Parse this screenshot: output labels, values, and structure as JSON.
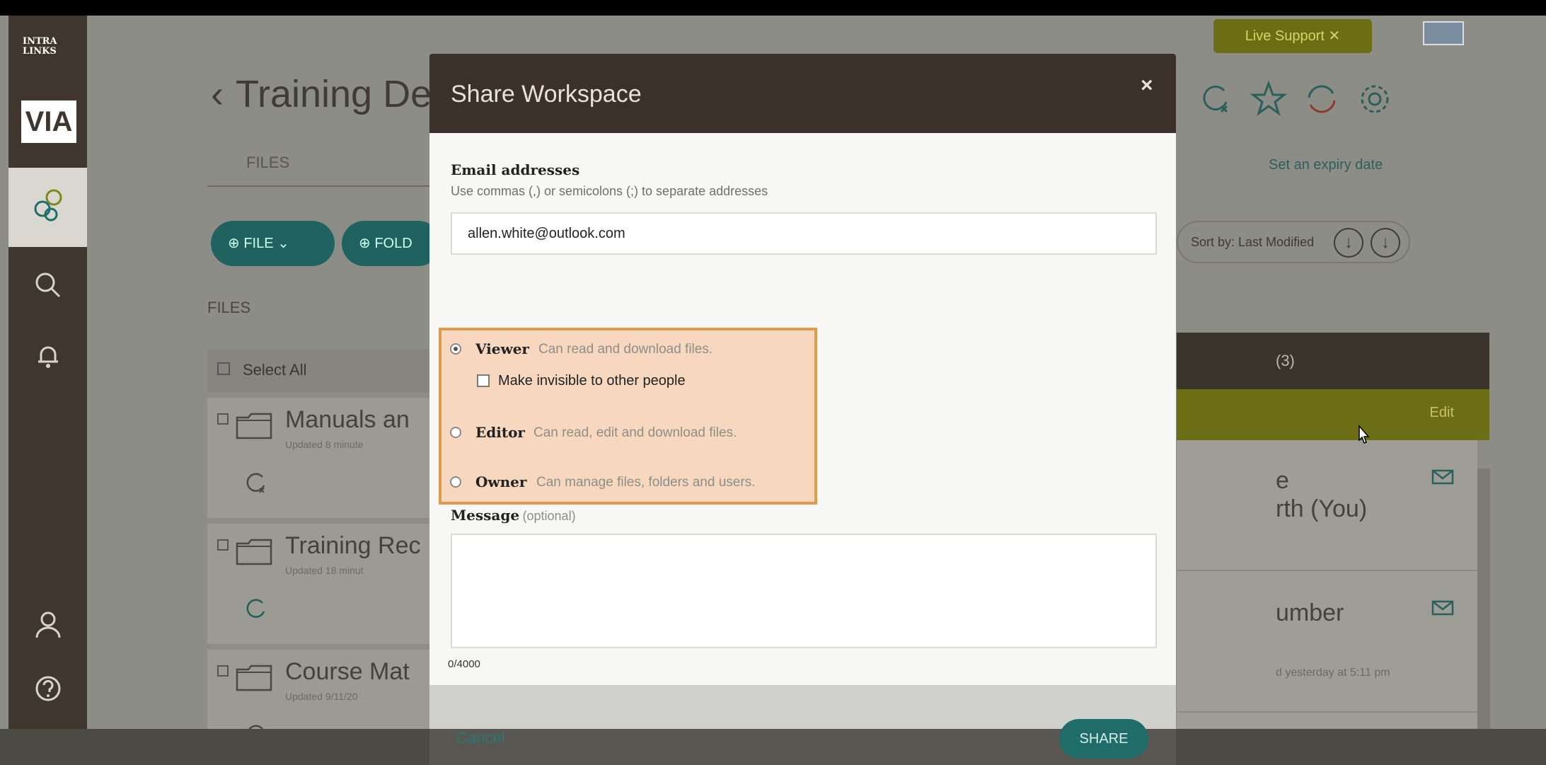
{
  "app": {
    "logo_top": "INTRA LINKS",
    "logo_bottom": "VIA",
    "live_support": "Live Support ✕"
  },
  "page": {
    "title": "Training Dep",
    "tab_files": "FILES",
    "buttons": {
      "file": "FILE",
      "folder": "FOLD"
    },
    "files_label": "FILES",
    "select_all": "Select All",
    "expiry_link": "Set an expiry date",
    "sort_label": "Sort by: Last Modified",
    "files": [
      {
        "name": "Manuals an",
        "updated": "Updated 8 minute"
      },
      {
        "name": "Training Rec",
        "updated": "Updated 18 minut"
      },
      {
        "name": "Course Mat",
        "updated": "Updated 9/11/20"
      }
    ]
  },
  "side_panel": {
    "header_count": "(3)",
    "olive_label": "Edit",
    "members": [
      {
        "line1": "e",
        "line2": "rth (You)"
      },
      {
        "line1": "umber",
        "line2": "d yesterday at 5:11 pm"
      }
    ]
  },
  "modal": {
    "title": "Share Workspace",
    "close": "×",
    "email_label": "Email addresses",
    "email_hint": "Use commas (,) or semicolons (;) to separate addresses",
    "email_value": "allen.white@outlook.com",
    "roles": [
      {
        "name": "Viewer",
        "desc": "Can read and download files.",
        "selected": true
      },
      {
        "name": "Editor",
        "desc": "Can read, edit and download files.",
        "selected": false
      },
      {
        "name": "Owner",
        "desc": "Can manage files, folders and users.",
        "selected": false
      }
    ],
    "invisible_label": "Make invisible to other people",
    "message_label": "Message",
    "message_optional": "(optional)",
    "message_counter": "0/4000",
    "cancel": "Cancel",
    "share": "SHARE"
  },
  "colors": {
    "nav_bg": "#3f372e",
    "modal_header": "#3c3128",
    "accent_teal": "#1f6c69",
    "highlight_fill": "#f7d8bf",
    "highlight_border": "#e09b53",
    "olive": "#6c6d15"
  },
  "icons": {
    "nav": [
      "workspaces-icon",
      "search-icon",
      "bell-icon",
      "user-icon",
      "help-icon",
      "download-icon"
    ],
    "toolbar": [
      "refresh-badge-icon",
      "star-icon",
      "sync-icon",
      "gear-icon"
    ]
  }
}
